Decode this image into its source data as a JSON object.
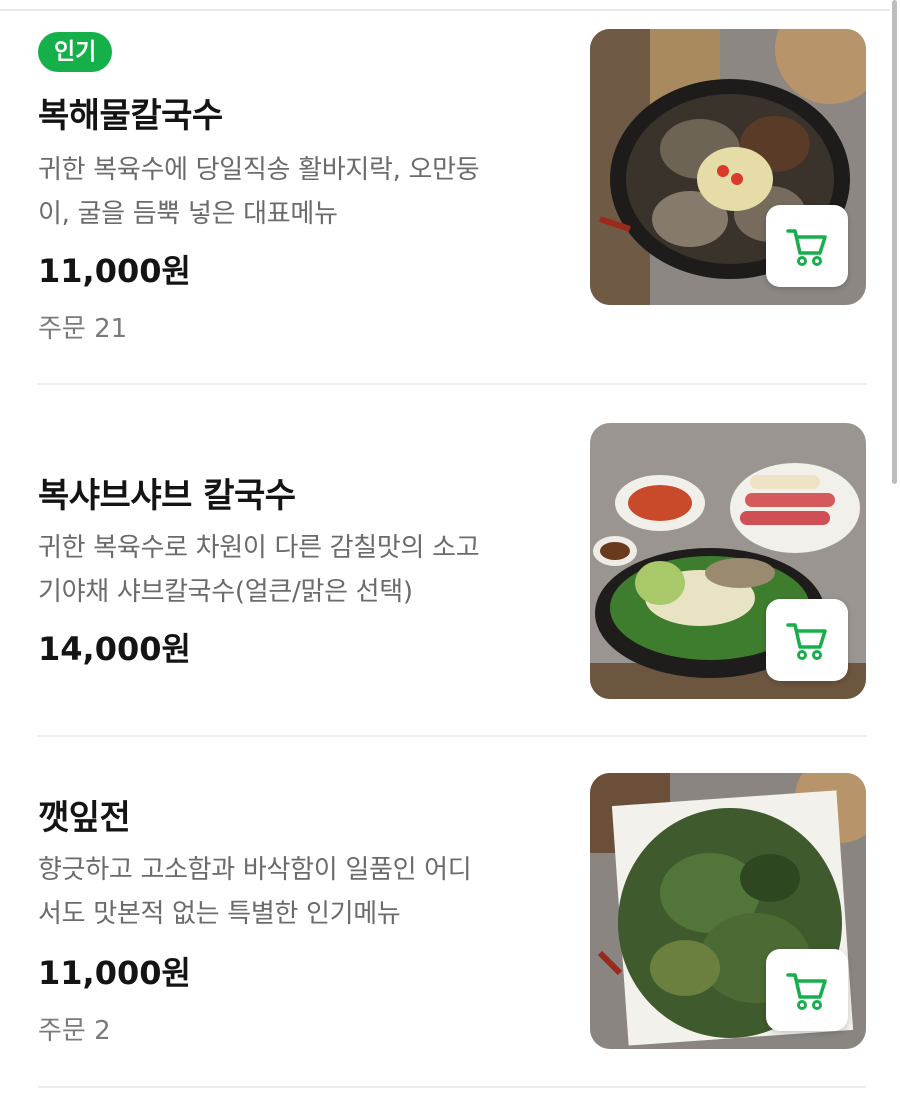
{
  "items": [
    {
      "badge": "인기",
      "name": "복해물칼국수",
      "desc_line1": "귀한 복육수에 당일직송 활바지락, 오만둥",
      "desc_line2": "이, 굴을 듬뿍 넣은 대표메뉴",
      "price": "11,000원",
      "orders": "주문 21",
      "image_icon": "seafood-noodle-photo",
      "cart_icon": "cart-icon"
    },
    {
      "name": "복샤브샤브 칼국수",
      "desc_line1": "귀한 복육수로 차원이 다른 감칠맛의 소고",
      "desc_line2": "기야채 샤브칼국수(얼큰/맑은 선택)",
      "price": "14,000원",
      "image_icon": "shabu-shabu-photo",
      "cart_icon": "cart-icon"
    },
    {
      "name": "깻잎전",
      "desc_line1": "향긋하고 고소함과 바삭함이 일품인 어디",
      "desc_line2": "서도 맛본적 없는 특별한 인기메뉴",
      "price": "11,000원",
      "orders": "주문 2",
      "image_icon": "perilla-pancake-photo",
      "cart_icon": "cart-icon"
    }
  ],
  "colors": {
    "accent": "#15b04a",
    "text": "#141414",
    "subtext": "#6b6b6b"
  }
}
